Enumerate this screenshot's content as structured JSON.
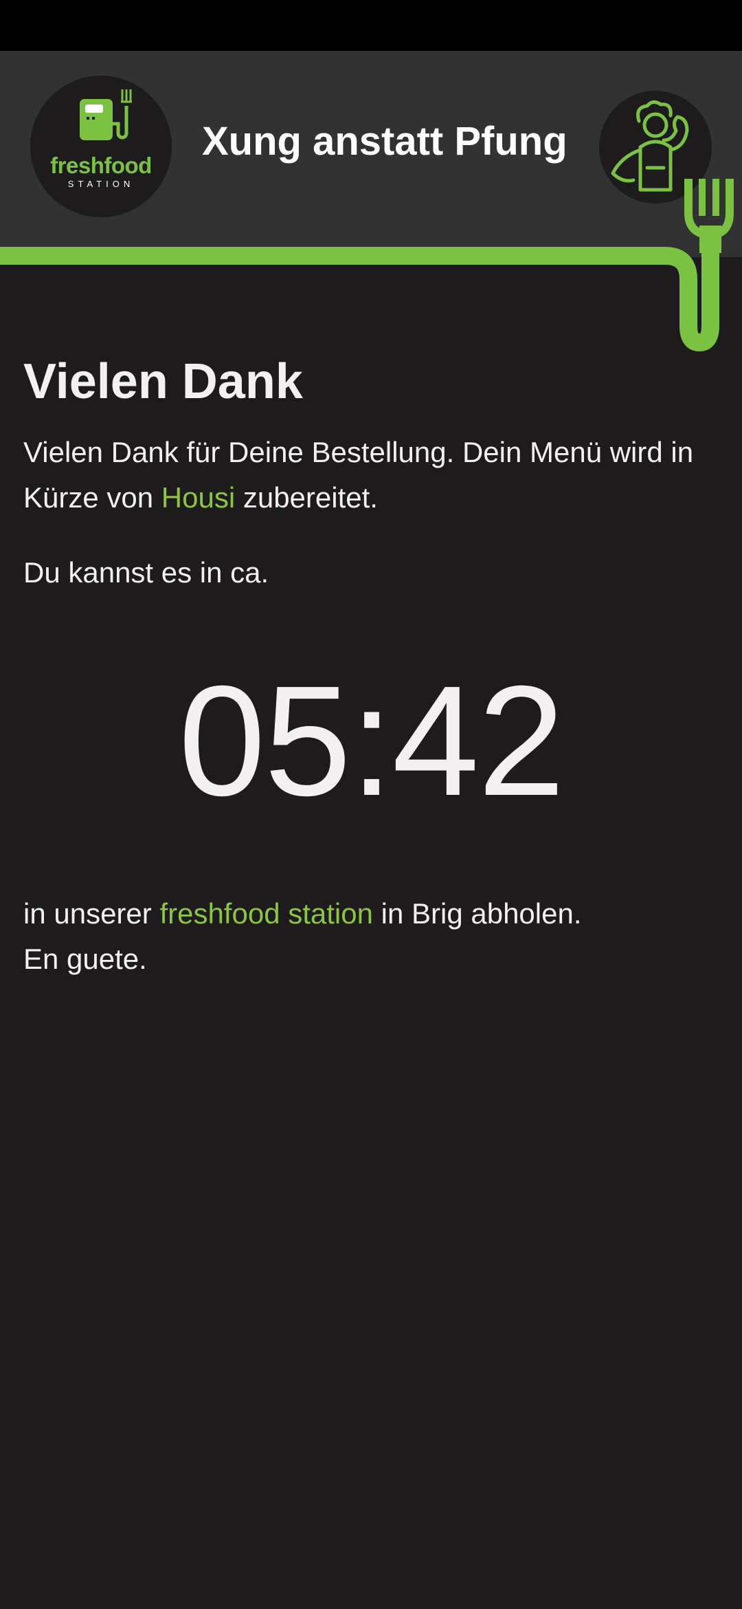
{
  "header": {
    "logo": {
      "icon": "fuel-pump-fork-icon",
      "brand": "freshfood",
      "sub": "STATION"
    },
    "title": "Xung anstatt Pfung",
    "avatar_icon": "chef-flexing-icon",
    "accent": "#7cc242"
  },
  "main": {
    "heading": "Vielen Dank",
    "para1": {
      "before": "Vielen Dank für Deine Bestellung. Dein Menü wird in Kürze von ",
      "highlight": "Housi",
      "after": " zubereitet."
    },
    "para2": "Du kannst es in ca.",
    "timer": "05:42",
    "para3": {
      "before": "in unserer ",
      "highlight": "freshfood station",
      "after": " in Brig abholen.",
      "line2": "En guete."
    }
  }
}
